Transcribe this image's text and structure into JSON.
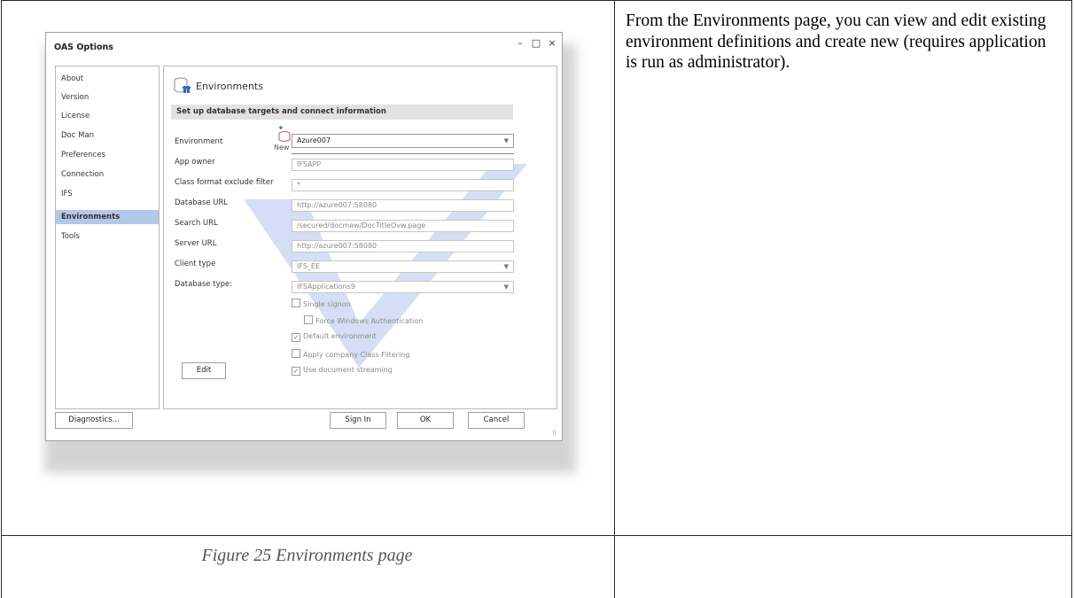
{
  "dialog": {
    "title": "OAS Options",
    "window_buttons": {
      "minimize": "–",
      "maximize": "□",
      "close": "×"
    }
  },
  "nav": {
    "items": [
      {
        "label": "About"
      },
      {
        "label": "Version"
      },
      {
        "label": "License"
      },
      {
        "label": "Doc Man"
      },
      {
        "label": "Preferences"
      },
      {
        "label": "Connection"
      },
      {
        "label": "IFS"
      },
      {
        "label": "Environments",
        "selected": true
      },
      {
        "label": "Tools"
      }
    ]
  },
  "panel": {
    "title": "Environments",
    "subheader": "Set up database targets and connect information",
    "new_label": "New",
    "environment_label": "Environment",
    "environment_value": "Azure007",
    "fields": [
      {
        "label": "App owner",
        "value": "IFSAPP"
      },
      {
        "label": "Class format exclude filter",
        "value": "*"
      },
      {
        "label": "Database URL",
        "value": "http://azure007:58080"
      },
      {
        "label": "Search URL",
        "value": "/secured/docmaw/DocTitleOvw.page"
      },
      {
        "label": "Server URL",
        "value": "http://azure007:58080"
      },
      {
        "label": "Client type",
        "value": "IFS_EE"
      },
      {
        "label": "Database type:",
        "value": "IFSApplications9"
      }
    ],
    "checkboxes": [
      {
        "label": "Single signon",
        "checked": false
      },
      {
        "label": "Force Windows Authentication",
        "checked": false
      },
      {
        "label": "Default environment",
        "checked": true
      },
      {
        "label": "Apply company Class Filtering",
        "checked": false
      },
      {
        "label": "Use document streaming",
        "checked": true
      }
    ],
    "edit_button": "Edit"
  },
  "footer": {
    "diagnostics_button": "Diagnostics...",
    "signin_button": "Sign In",
    "ok_button": "OK",
    "cancel_button": "Cancel"
  },
  "document": {
    "description": "From the Environments page, you can view and edit existing environment definitions and create new (requires application is run as administrator).",
    "caption": "Figure 25 Environments page"
  },
  "colors": {
    "nav_selected": "#b3c7e8",
    "subheader_bg": "#e2e2e2",
    "watermark": "#1e50c8"
  }
}
